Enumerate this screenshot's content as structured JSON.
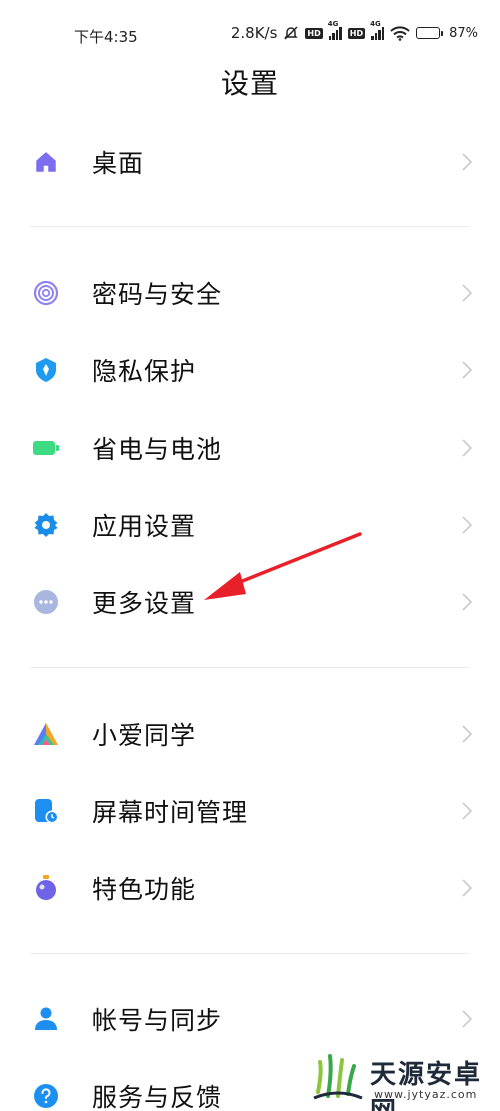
{
  "status_bar": {
    "time": "下午4:35",
    "network_speed": "2.8K/s",
    "battery_percent": "87",
    "battery_level": 0.87,
    "icons": [
      "silent-icon",
      "hd-icon",
      "signal-4g-icon",
      "hd-icon",
      "signal-4g-icon",
      "wifi-icon",
      "battery-icon"
    ],
    "hd_label": "HD",
    "net_label": "4G"
  },
  "header": {
    "title": "设置"
  },
  "sections": [
    {
      "items": [
        {
          "label": "桌面",
          "icon": "home-icon",
          "color": "#7c6cf0"
        }
      ]
    },
    {
      "items": [
        {
          "label": "密码与安全",
          "icon": "fingerprint-icon",
          "color": "#8f82f2"
        },
        {
          "label": "隐私保护",
          "icon": "privacy-shield-icon",
          "color": "#1d9bf0"
        },
        {
          "label": "省电与电池",
          "icon": "battery-saver-icon",
          "color": "#3ddc84"
        },
        {
          "label": "应用设置",
          "icon": "app-settings-gear-icon",
          "color": "#1a8de8"
        },
        {
          "label": "更多设置",
          "icon": "more-dots-icon",
          "color": "#a9b6df"
        }
      ]
    },
    {
      "items": [
        {
          "label": "小爱同学",
          "icon": "xiaoai-icon",
          "color": "#5a7cf5"
        },
        {
          "label": "屏幕时间管理",
          "icon": "screen-time-icon",
          "color": "#1d8ff0"
        },
        {
          "label": "特色功能",
          "icon": "features-icon",
          "color": "#6f63e8"
        }
      ]
    },
    {
      "items": [
        {
          "label": "帐号与同步",
          "icon": "account-icon",
          "color": "#1d8ff0"
        },
        {
          "label": "服务与反馈",
          "icon": "feedback-icon",
          "color": "#1d8ff0"
        }
      ]
    }
  ],
  "colors": {
    "chevron": "#c4c4c4",
    "annotation_arrow": "#e8202a"
  },
  "watermark": {
    "brand": "天源安卓网",
    "url": "www.jytyaz.com"
  }
}
